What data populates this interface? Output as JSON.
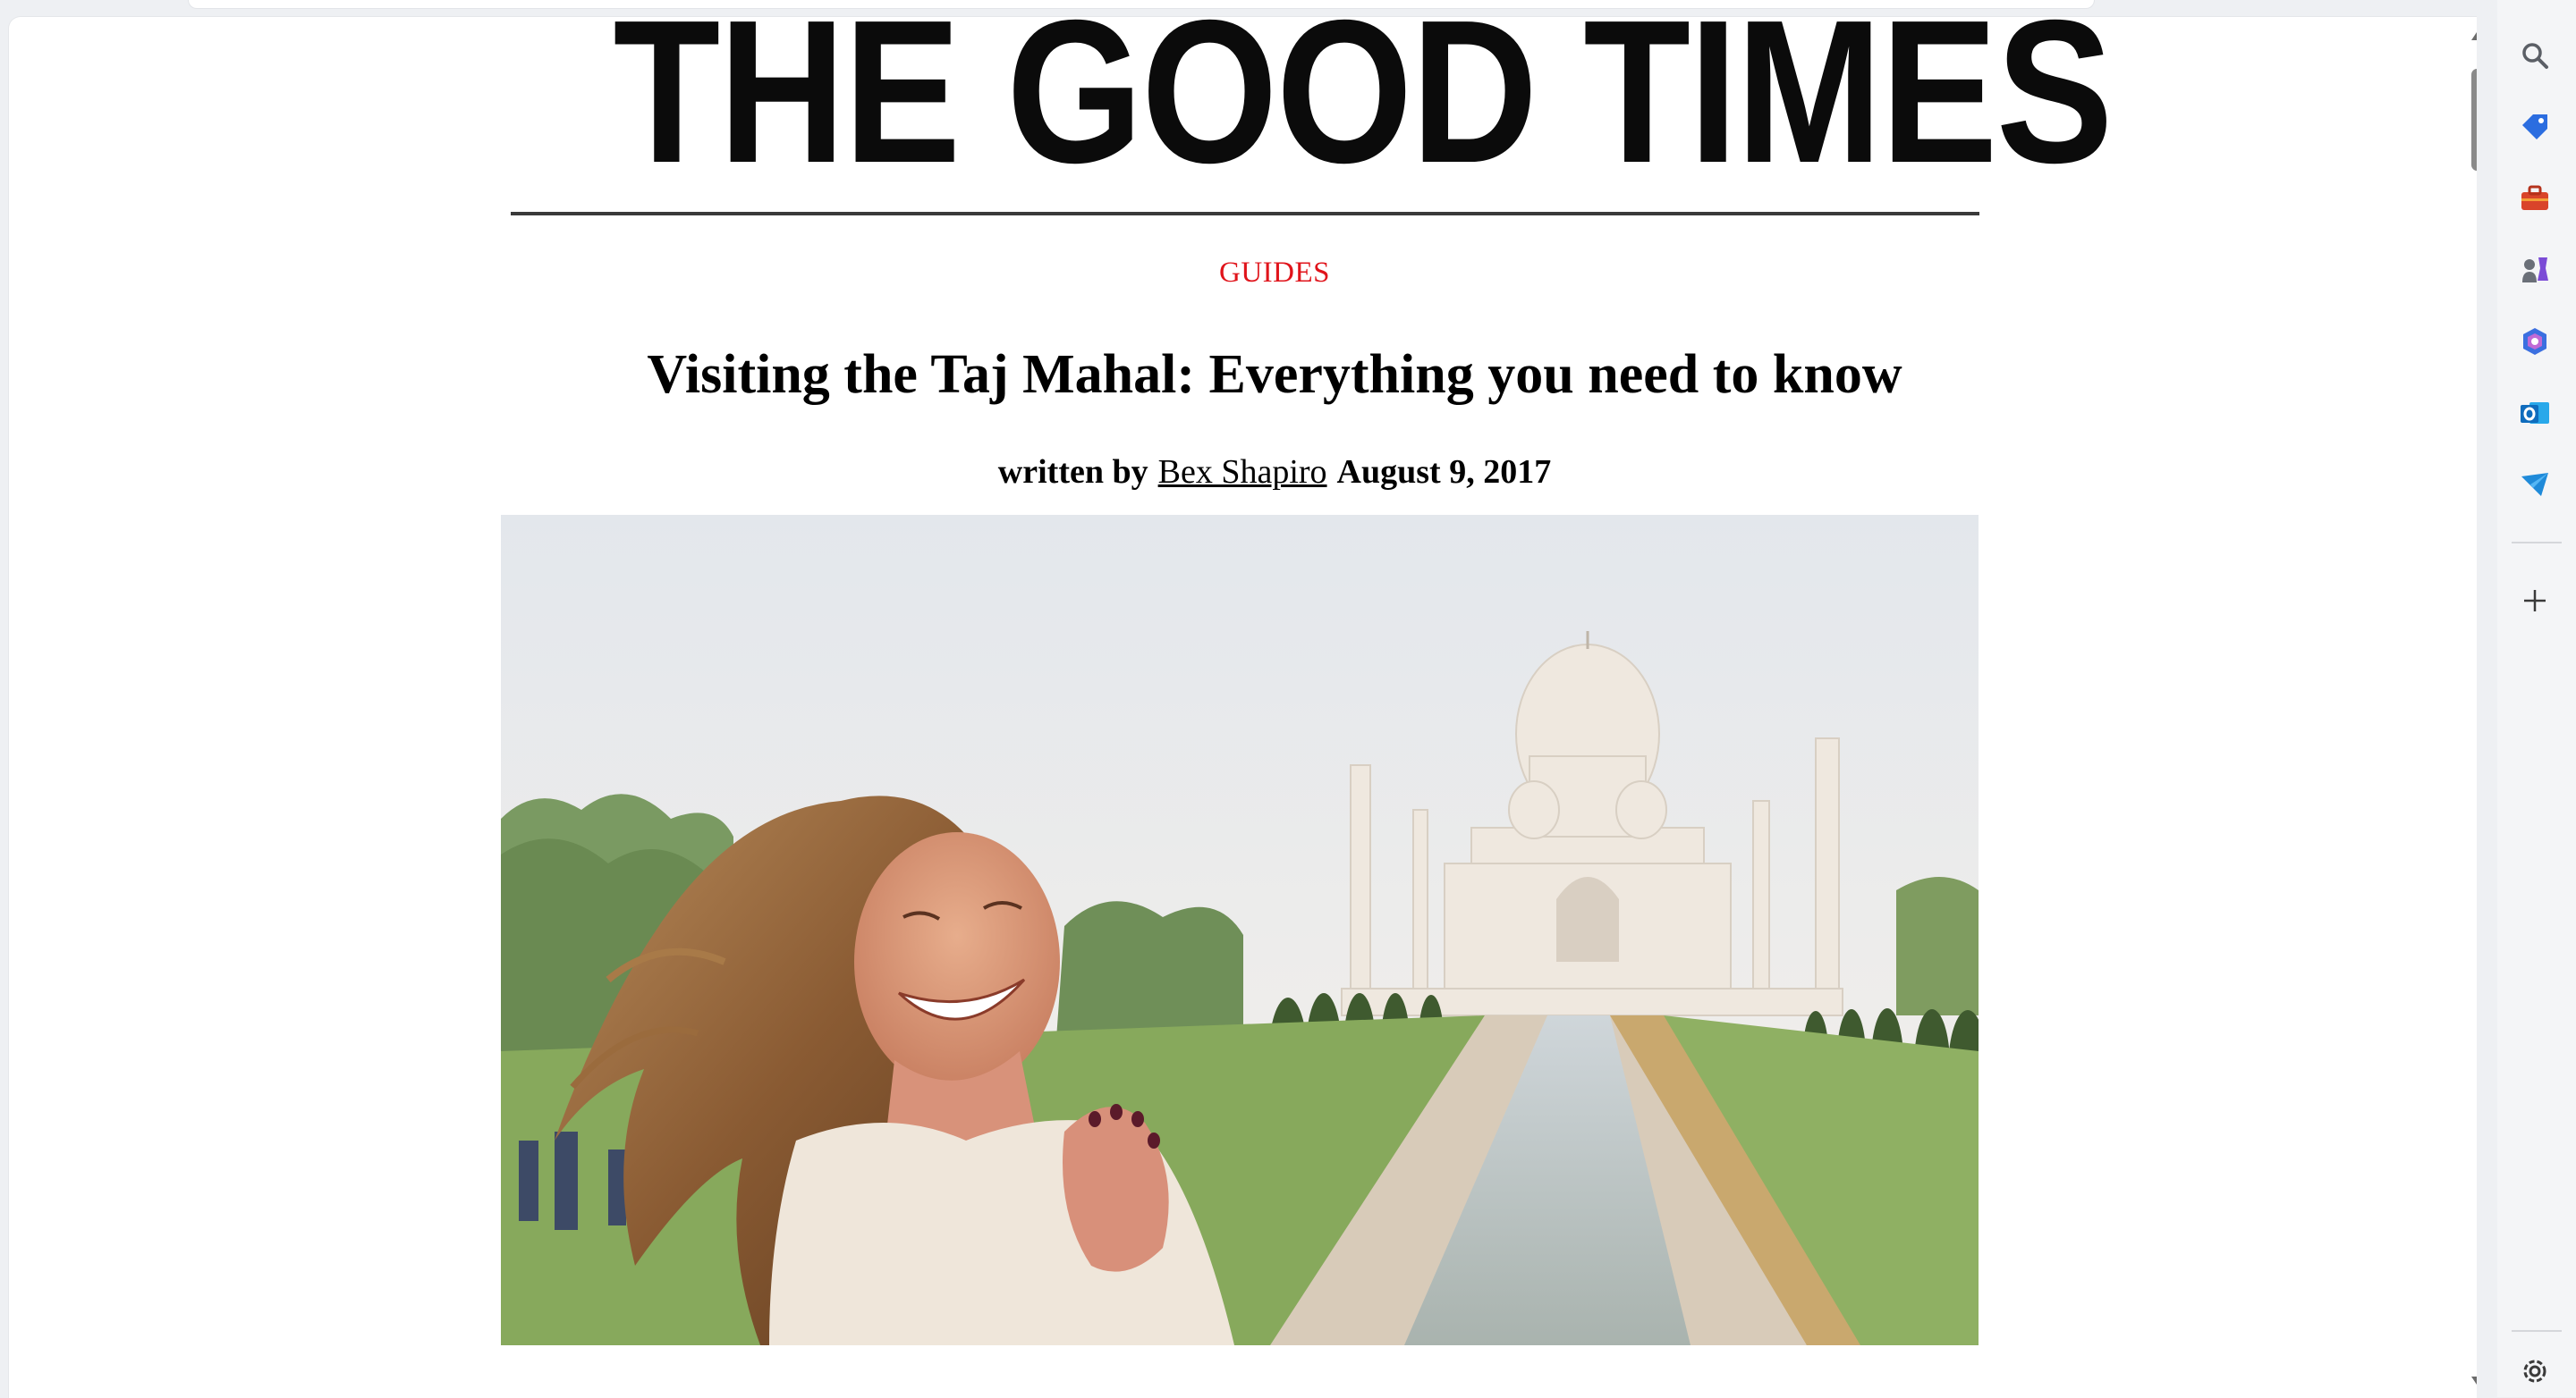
{
  "masthead": {
    "title": "THE GOOD TIMES"
  },
  "article": {
    "category": "GUIDES",
    "headline": "Visiting the Taj Mahal: Everything you need to know",
    "byline_prefix": "written by",
    "author": "Bex Shapiro",
    "date": "August 9, 2017"
  },
  "hero_image": {
    "alt": "Woman laughing in front of the Taj Mahal"
  },
  "sidebar": {
    "items": [
      {
        "name": "search-icon",
        "color": "#5b5f66"
      },
      {
        "name": "shopping-tag-icon",
        "color": "#2b6de0"
      },
      {
        "name": "toolbox-icon",
        "color": "#d9442a"
      },
      {
        "name": "games-icon",
        "color": "#7b4bd6"
      },
      {
        "name": "copilot-icon",
        "color": "#3b6fe0"
      },
      {
        "name": "outlook-icon",
        "color": "#0f6cbd"
      },
      {
        "name": "telegram-icon",
        "color": "#1f8ad9"
      },
      {
        "name": "add-icon",
        "color": "#3a3a3a"
      },
      {
        "name": "settings-icon",
        "color": "#3a3a3a"
      }
    ]
  },
  "colors": {
    "category_red": "#e0141b",
    "text": "#000000",
    "accent_blue": "#0f6cbd"
  }
}
